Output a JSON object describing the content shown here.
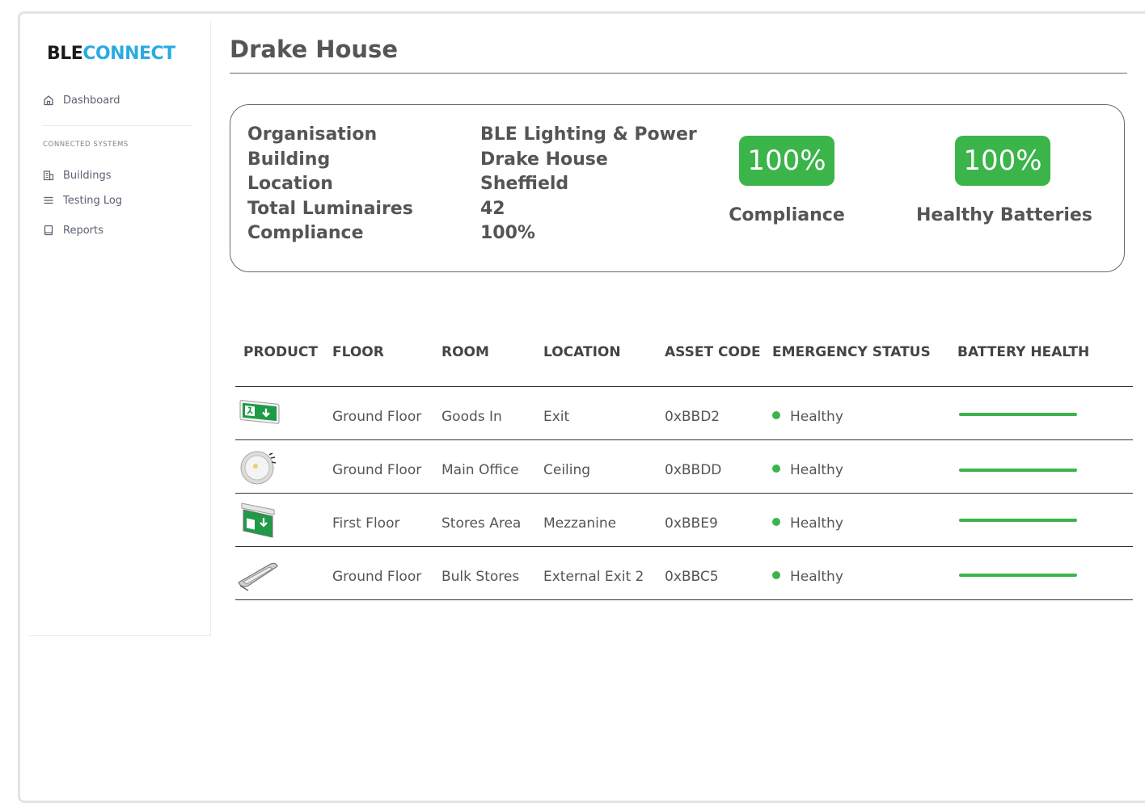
{
  "brand": {
    "logo_ble": "BLE",
    "logo_connect": "CONNECT",
    "brand_blue": "#29abe2"
  },
  "sidebar": {
    "dashboard_label": "Dashboard",
    "section_label": "CONNECTED SYSTEMS",
    "items": [
      {
        "label": "Buildings",
        "icon": "building-icon"
      },
      {
        "label": "Testing Log",
        "icon": "list-icon"
      },
      {
        "label": "Reports",
        "icon": "book-icon"
      }
    ]
  },
  "page": {
    "title": "Drake House"
  },
  "summary": {
    "rows": [
      {
        "label": "Organisation",
        "value": "BLE Lighting & Power"
      },
      {
        "label": "Building",
        "value": "Drake House"
      },
      {
        "label": "Location",
        "value": "Sheffield"
      },
      {
        "label": "Total Luminaires",
        "value": "42"
      },
      {
        "label": "Compliance",
        "value": "100%"
      }
    ],
    "kpis": [
      {
        "value": "100%",
        "label": "Compliance"
      },
      {
        "value": "100%",
        "label": "Healthy Batteries"
      }
    ],
    "accent_green": "#3bb44a"
  },
  "table": {
    "headers": [
      "PRODUCT",
      "FLOOR",
      "ROOM",
      "LOCATION",
      "ASSET CODE",
      "EMERGENCY STATUS",
      "BATTERY HEALTH"
    ],
    "rows": [
      {
        "product": "exit-sign-arrow-down",
        "floor": "Ground Floor",
        "room": "Goods In",
        "location": "Exit",
        "asset_code": "0xBBD2",
        "status": "Healthy",
        "battery_health": 1.0
      },
      {
        "product": "round-downlight",
        "floor": "Ground Floor",
        "room": "Main Office",
        "location": "Ceiling",
        "asset_code": "0xBBDD",
        "status": "Healthy",
        "battery_health": 1.0
      },
      {
        "product": "suspended-exit-sign",
        "floor": "First Floor",
        "room": "Stores Area",
        "location": "Mezzanine",
        "asset_code": "0xBBE9",
        "status": "Healthy",
        "battery_health": 1.0
      },
      {
        "product": "bulkhead-light",
        "floor": "Ground Floor",
        "room": "Bulk Stores",
        "location": "External Exit 2",
        "asset_code": "0xBBC5",
        "status": "Healthy",
        "battery_health": 1.0
      }
    ]
  }
}
